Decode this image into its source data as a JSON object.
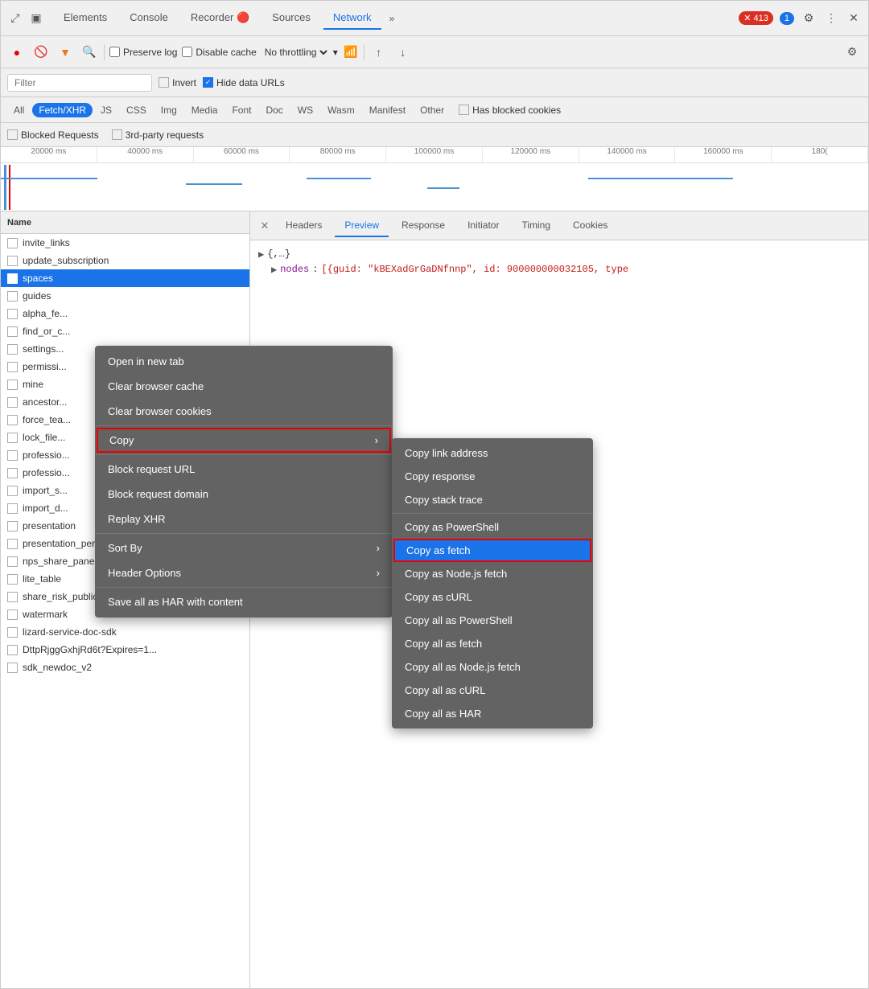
{
  "devtools": {
    "tabs": [
      {
        "label": "Elements",
        "active": false
      },
      {
        "label": "Console",
        "active": false
      },
      {
        "label": "Recorder 🔴",
        "active": false
      },
      {
        "label": "Sources",
        "active": false
      },
      {
        "label": "Network",
        "active": true
      }
    ],
    "more_tabs_icon": "»",
    "error_badge": "413",
    "info_badge": "1",
    "gear_icon": "⚙",
    "more_icon": "⋮",
    "close_icon": "✕"
  },
  "toolbar": {
    "record_title": "Record",
    "stop_title": "Stop",
    "clear_title": "Clear",
    "filter_title": "Filter",
    "search_title": "Search",
    "preserve_log": "Preserve log",
    "disable_cache": "Disable cache",
    "throttle_label": "No throttling",
    "upload_icon": "↑",
    "download_icon": "↓",
    "settings_icon": "⚙"
  },
  "filter_bar": {
    "placeholder": "Filter",
    "invert_label": "Invert",
    "hide_data_urls_label": "Hide data URLs",
    "hide_data_urls_checked": true
  },
  "type_filters": [
    {
      "label": "All",
      "active": false
    },
    {
      "label": "Fetch/XHR",
      "active": true
    },
    {
      "label": "JS",
      "active": false
    },
    {
      "label": "CSS",
      "active": false
    },
    {
      "label": "Img",
      "active": false
    },
    {
      "label": "Media",
      "active": false
    },
    {
      "label": "Font",
      "active": false
    },
    {
      "label": "Doc",
      "active": false
    },
    {
      "label": "WS",
      "active": false
    },
    {
      "label": "Wasm",
      "active": false
    },
    {
      "label": "Manifest",
      "active": false
    },
    {
      "label": "Other",
      "active": false
    },
    {
      "label": "Has blocked cookies",
      "active": false
    }
  ],
  "blocked_bar": {
    "blocked_requests": "Blocked Requests",
    "third_party": "3rd-party requests"
  },
  "timeline": {
    "labels": [
      "20000 ms",
      "40000 ms",
      "60000 ms",
      "80000 ms",
      "100000 ms",
      "120000 ms",
      "140000 ms",
      "160000 ms",
      "180("
    ]
  },
  "network_list": {
    "header": "Name",
    "items": [
      {
        "name": "invite_links",
        "selected": false
      },
      {
        "name": "update_subscription",
        "selected": false
      },
      {
        "name": "spaces",
        "selected": true
      },
      {
        "name": "guides",
        "selected": false
      },
      {
        "name": "alpha_fe...",
        "selected": false
      },
      {
        "name": "find_or_c...",
        "selected": false
      },
      {
        "name": "settings...",
        "selected": false
      },
      {
        "name": "permissi...",
        "selected": false
      },
      {
        "name": "mine",
        "selected": false
      },
      {
        "name": "ancestor...",
        "selected": false
      },
      {
        "name": "force_tea...",
        "selected": false
      },
      {
        "name": "lock_file...",
        "selected": false
      },
      {
        "name": "professio...",
        "selected": false
      },
      {
        "name": "professio...",
        "selected": false
      },
      {
        "name": "import_s...",
        "selected": false
      },
      {
        "name": "import_d...",
        "selected": false
      },
      {
        "name": "presentation",
        "selected": false
      },
      {
        "name": "presentation_personal",
        "selected": false
      },
      {
        "name": "nps_share_panel",
        "selected": false
      },
      {
        "name": "lite_table",
        "selected": false
      },
      {
        "name": "share_risk_public_share",
        "selected": false
      },
      {
        "name": "watermark",
        "selected": false
      },
      {
        "name": "lizard-service-doc-sdk",
        "selected": false
      },
      {
        "name": "DttpRjggGxhjRd6t?Expires=1...",
        "selected": false
      },
      {
        "name": "sdk_newdoc_v2",
        "selected": false
      }
    ]
  },
  "detail_panel": {
    "close_icon": "✕",
    "tabs": [
      {
        "label": "Headers",
        "active": false
      },
      {
        "label": "Preview",
        "active": true
      },
      {
        "label": "Response",
        "active": false
      },
      {
        "label": "Initiator",
        "active": false
      },
      {
        "label": "Timing",
        "active": false
      },
      {
        "label": "Cookies",
        "active": false
      }
    ],
    "json_preview": {
      "root": "{,…}",
      "nodes_key": "nodes",
      "nodes_value": "[{guid: \"kBEXadGrGaDNfnnp\", id: 900000000032105, type"
    }
  },
  "context_menu": {
    "items": [
      {
        "label": "Open in new tab",
        "has_submenu": false,
        "separator_after": false
      },
      {
        "label": "Clear browser cache",
        "has_submenu": false,
        "separator_after": false
      },
      {
        "label": "Clear browser cookies",
        "has_submenu": false,
        "separator_after": true
      },
      {
        "label": "Copy",
        "has_submenu": true,
        "separator_after": true,
        "highlighted": false
      },
      {
        "label": "Block request URL",
        "has_submenu": false,
        "separator_after": false
      },
      {
        "label": "Block request domain",
        "has_submenu": false,
        "separator_after": false
      },
      {
        "label": "Replay XHR",
        "has_submenu": false,
        "separator_after": true
      },
      {
        "label": "Sort By",
        "has_submenu": true,
        "separator_after": false
      },
      {
        "label": "Header Options",
        "has_submenu": true,
        "separator_after": true
      },
      {
        "label": "Save all as HAR with content",
        "has_submenu": false,
        "separator_after": false
      }
    ]
  },
  "submenu": {
    "items": [
      {
        "label": "Copy link address",
        "separator_after": false
      },
      {
        "label": "Copy response",
        "separator_after": false
      },
      {
        "label": "Copy stack trace",
        "separator_after": true
      },
      {
        "label": "Copy as PowerShell",
        "separator_after": false
      },
      {
        "label": "Copy as fetch",
        "separator_after": false,
        "active": true
      },
      {
        "label": "Copy as Node.js fetch",
        "separator_after": false
      },
      {
        "label": "Copy as cURL",
        "separator_after": false
      },
      {
        "label": "Copy all as PowerShell",
        "separator_after": false
      },
      {
        "label": "Copy all as fetch",
        "separator_after": false
      },
      {
        "label": "Copy all as Node.js fetch",
        "separator_after": false
      },
      {
        "label": "Copy all as cURL",
        "separator_after": false
      },
      {
        "label": "Copy all as HAR",
        "separator_after": false
      }
    ]
  }
}
